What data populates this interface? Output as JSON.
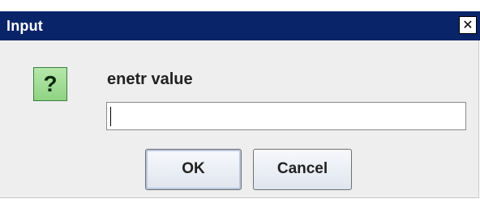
{
  "window": {
    "title": "Input",
    "close_symbol": "✕"
  },
  "message": {
    "icon": "question-icon",
    "icon_glyph": "?",
    "prompt": "enetr value"
  },
  "input": {
    "value": "",
    "placeholder": ""
  },
  "buttons": {
    "ok_label": "OK",
    "cancel_label": "Cancel"
  },
  "colors": {
    "titlebar": "#0a246a",
    "dialog_bg": "#eeeeee",
    "icon_green": "#8fd382"
  }
}
